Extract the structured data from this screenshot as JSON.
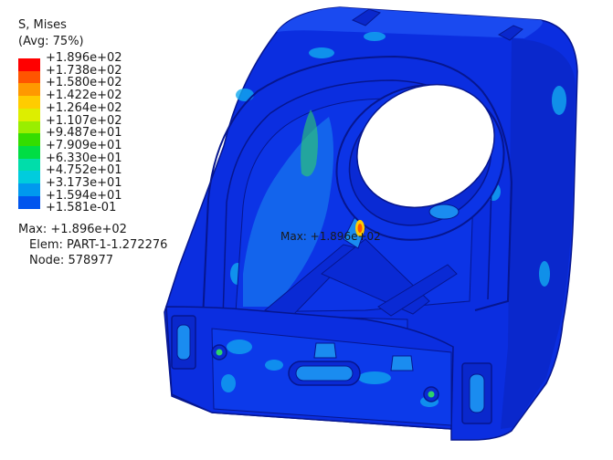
{
  "legend": {
    "title": "S, Mises",
    "subtitle": "(Avg: 75%)",
    "bands": [
      {
        "label": "+1.896e+02",
        "color": "#ff0000"
      },
      {
        "label": "+1.738e+02",
        "color": "#ff5500"
      },
      {
        "label": "+1.580e+02",
        "color": "#ff9900"
      },
      {
        "label": "+1.422e+02",
        "color": "#ffcc00"
      },
      {
        "label": "+1.264e+02",
        "color": "#ddee00"
      },
      {
        "label": "+1.107e+02",
        "color": "#99ee00"
      },
      {
        "label": "+9.487e+01",
        "color": "#33dd00"
      },
      {
        "label": "+7.909e+01",
        "color": "#00dd44"
      },
      {
        "label": "+6.330e+01",
        "color": "#00ddaa"
      },
      {
        "label": "+4.752e+01",
        "color": "#00ccdd"
      },
      {
        "label": "+3.173e+01",
        "color": "#0099ee"
      },
      {
        "label": "+1.594e+01",
        "color": "#0055ee"
      },
      {
        "label": "+1.581e-01",
        "color": "#0000ff"
      }
    ]
  },
  "max_info": {
    "max": "Max: +1.896e+02",
    "elem": "Elem: PART-1-1.272276",
    "node": "Node: 578977"
  },
  "marker": {
    "label": "Max: +1.896e+02"
  },
  "colors": {
    "base": "#0b2ee0",
    "dark": "#06168f",
    "mid": "#1060ff",
    "cyan": "#11aaf0",
    "green": "#2ed16a"
  }
}
